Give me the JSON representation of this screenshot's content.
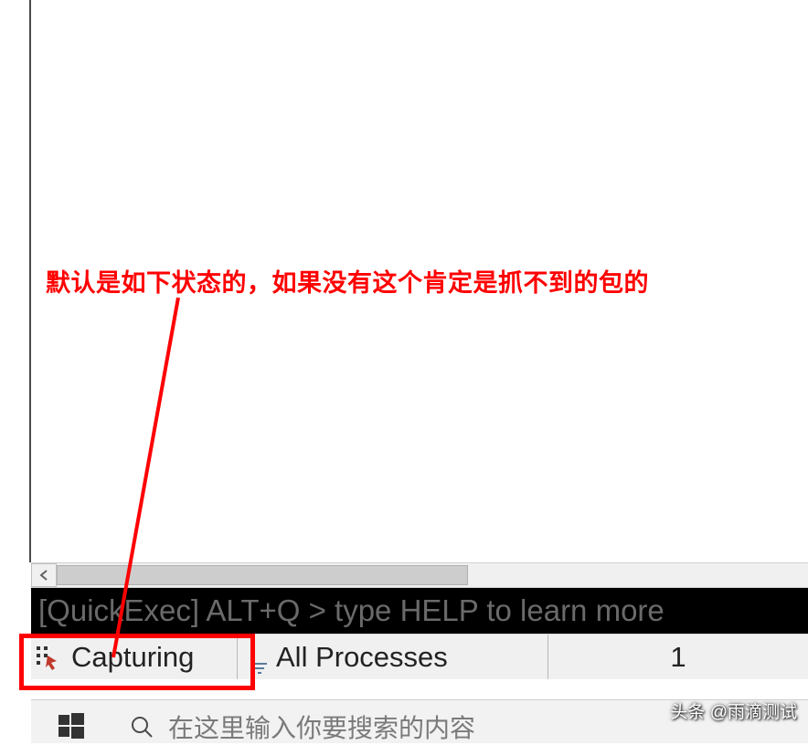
{
  "annotation": {
    "text": "默认是如下状态的，如果没有这个肯定是抓不到的包的"
  },
  "quickexec": {
    "placeholder": "[QuickExec] ALT+Q > type HELP to learn more"
  },
  "statusbar": {
    "capturing_label": "Capturing",
    "processes_label": "All Processes",
    "count": "1"
  },
  "taskbar": {
    "search_placeholder": "在这里输入你要搜索的内容"
  },
  "watermark": "头条 @雨滴测试"
}
